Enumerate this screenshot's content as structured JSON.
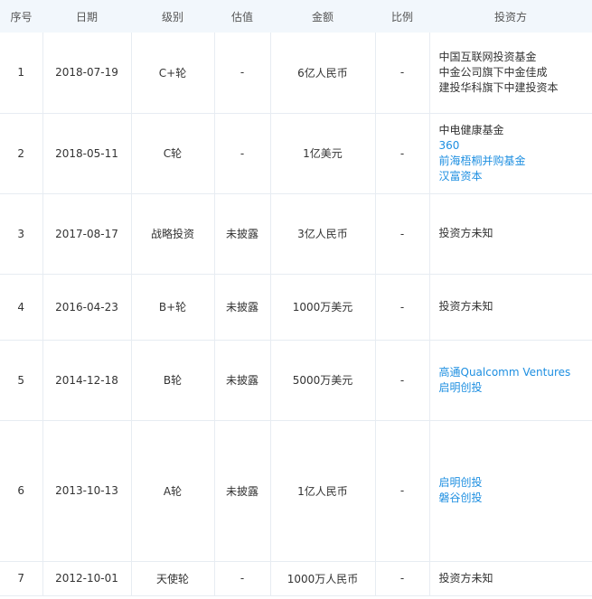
{
  "headers": [
    "序号",
    "日期",
    "级别",
    "估值",
    "金额",
    "比例",
    "投资方"
  ],
  "rows": [
    {
      "no": "1",
      "date": "2018-07-19",
      "round": "C+轮",
      "valuation": "-",
      "amount": "6亿人民币",
      "ratio": "-",
      "investors": [
        {
          "name": "中国互联网投资基金",
          "link": false
        },
        {
          "name": "中金公司旗下中金佳成",
          "link": false
        },
        {
          "name": "建投华科旗下中建投资本",
          "link": false
        }
      ]
    },
    {
      "no": "2",
      "date": "2018-05-11",
      "round": "C轮",
      "valuation": "-",
      "amount": "1亿美元",
      "ratio": "-",
      "investors": [
        {
          "name": "中电健康基金",
          "link": false
        },
        {
          "name": "360",
          "link": true
        },
        {
          "name": "前海梧桐并购基金",
          "link": true
        },
        {
          "name": "汉富资本",
          "link": true
        }
      ]
    },
    {
      "no": "3",
      "date": "2017-08-17",
      "round": "战略投资",
      "valuation": "未披露",
      "amount": "3亿人民币",
      "ratio": "-",
      "investors": [
        {
          "name": "投资方未知",
          "link": false
        }
      ]
    },
    {
      "no": "4",
      "date": "2016-04-23",
      "round": "B+轮",
      "valuation": "未披露",
      "amount": "1000万美元",
      "ratio": "-",
      "investors": [
        {
          "name": "投资方未知",
          "link": false
        }
      ]
    },
    {
      "no": "5",
      "date": "2014-12-18",
      "round": "B轮",
      "valuation": "未披露",
      "amount": "5000万美元",
      "ratio": "-",
      "investors": [
        {
          "name": "高通Qualcomm Ventures",
          "link": true
        },
        {
          "name": "启明创投",
          "link": true
        }
      ]
    },
    {
      "no": "6",
      "date": "2013-10-13",
      "round": "A轮",
      "valuation": "未披露",
      "amount": "1亿人民币",
      "ratio": "-",
      "investors": [
        {
          "name": "启明创投",
          "link": true
        },
        {
          "name": "磐谷创投",
          "link": true
        }
      ]
    },
    {
      "no": "7",
      "date": "2012-10-01",
      "round": "天使轮",
      "valuation": "-",
      "amount": "1000万人民币",
      "ratio": "-",
      "investors": [
        {
          "name": "投资方未知",
          "link": false
        }
      ]
    }
  ]
}
